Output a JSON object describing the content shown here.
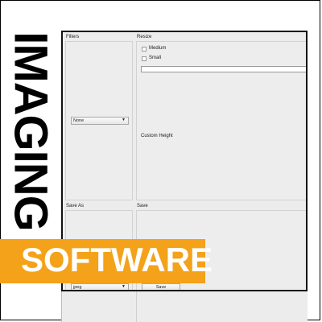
{
  "vertical_title": "IMAGING",
  "banner_text": "SOFTWARE",
  "colors": {
    "banner": "#f4a21a",
    "window_bg": "#ececec"
  },
  "filters": {
    "title": "Filters",
    "selected": "None"
  },
  "resize": {
    "title": "Resize",
    "options": [
      "Medium",
      "Small"
    ],
    "custom_height_label": "Custom Height"
  },
  "save_as": {
    "title": "Save As",
    "selected": "jpeg"
  },
  "save": {
    "title": "Save",
    "button_label": "Save"
  }
}
